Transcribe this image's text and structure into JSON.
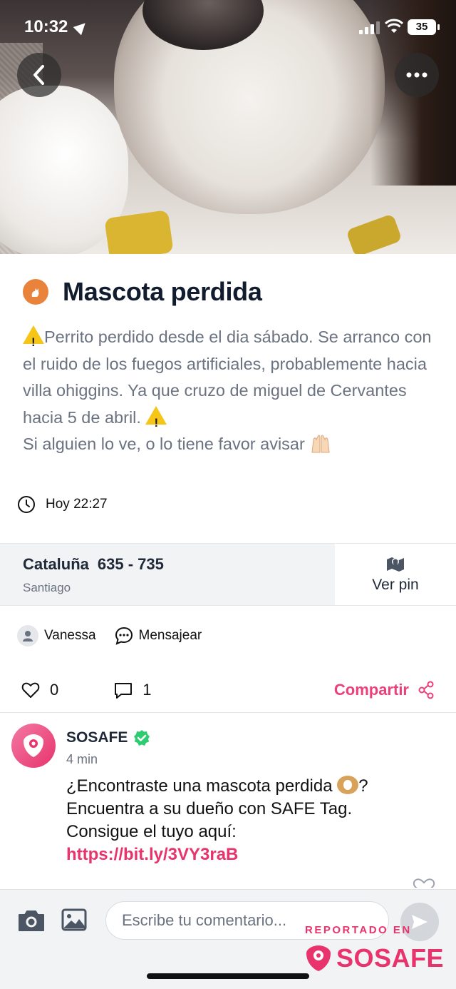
{
  "status_bar": {
    "time": "10:32",
    "battery": "35"
  },
  "post": {
    "title": "Mascota perdida",
    "description": "Perrito perdido desde el dia sábado. Se arranco con el ruido de los fuegos artificiales, probablemente hacia villa ohiggins. Ya que cruzo de miguel de Cervantes hacia 5 de abril.",
    "description_line2": "Si alguien lo ve, o lo tiene favor avisar",
    "timestamp": "Hoy 22:27",
    "address_street": "Cataluña",
    "address_range": "635 - 735",
    "city": "Santiago",
    "ver_pin": "Ver pin",
    "author": "Vanessa",
    "message_label": "Mensajear",
    "likes": "0",
    "comments": "1",
    "share_label": "Compartir"
  },
  "comment": {
    "author": "SOSAFE",
    "time": "4 min",
    "text_part1": "¿Encontraste una mascota perdida",
    "text_part2": "? Encuentra a su dueño con SAFE Tag. Consigue el tuyo aquí:",
    "link": "https://bit.ly/3VY3raB"
  },
  "composer": {
    "placeholder": "Escribe tu comentario..."
  },
  "watermark": {
    "top": "REPORTADO EN",
    "brand": "SOSAFE"
  },
  "colors": {
    "brand": "#e8336d",
    "accent_orange": "#e9833b",
    "verified": "#2ecc71"
  }
}
